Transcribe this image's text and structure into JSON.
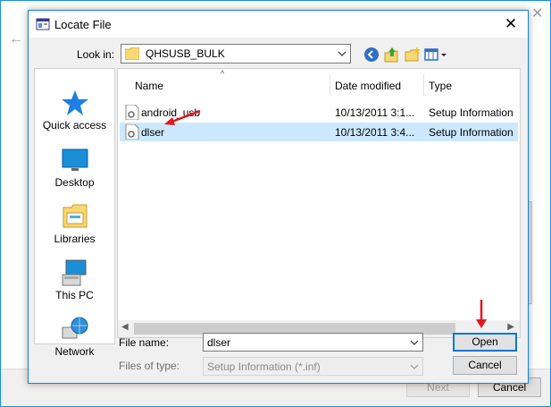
{
  "dialog": {
    "title": "Locate File",
    "close_glyph": "✕",
    "look_in_label": "Look in:",
    "look_in_value": "QHSUSB_BULK",
    "toolbar_icons": [
      "back-icon",
      "up-folder-icon",
      "new-folder-icon",
      "view-menu-icon"
    ]
  },
  "places": [
    {
      "label": "Quick access",
      "icon": "quick-access-star-icon"
    },
    {
      "label": "Desktop",
      "icon": "desktop-icon"
    },
    {
      "label": "Libraries",
      "icon": "libraries-icon"
    },
    {
      "label": "This PC",
      "icon": "this-pc-icon"
    },
    {
      "label": "Network",
      "icon": "network-icon"
    }
  ],
  "filelist": {
    "sort_caret": "^",
    "columns": [
      "Name",
      "Date modified",
      "Type"
    ],
    "rows": [
      {
        "name": "android_usb",
        "date": "10/13/2011 3:1...",
        "type": "Setup Information",
        "selected": false
      },
      {
        "name": "dlser",
        "date": "10/13/2011 3:4...",
        "type": "Setup Information",
        "selected": true
      }
    ]
  },
  "file_name": {
    "label": "File name:",
    "value": "dlser"
  },
  "file_type": {
    "label": "Files of type:",
    "value": "Setup Information (*.inf)"
  },
  "buttons": {
    "open": "Open",
    "cancel": "Cancel"
  },
  "background_window": {
    "back_glyph": "←",
    "close_glyph": "✕",
    "next_label": "Next",
    "cancel_label": "Cancel"
  },
  "colors": {
    "accent": "#0078d7",
    "selection": "#cce8ff",
    "annotation_arrow": "#e8141e"
  }
}
